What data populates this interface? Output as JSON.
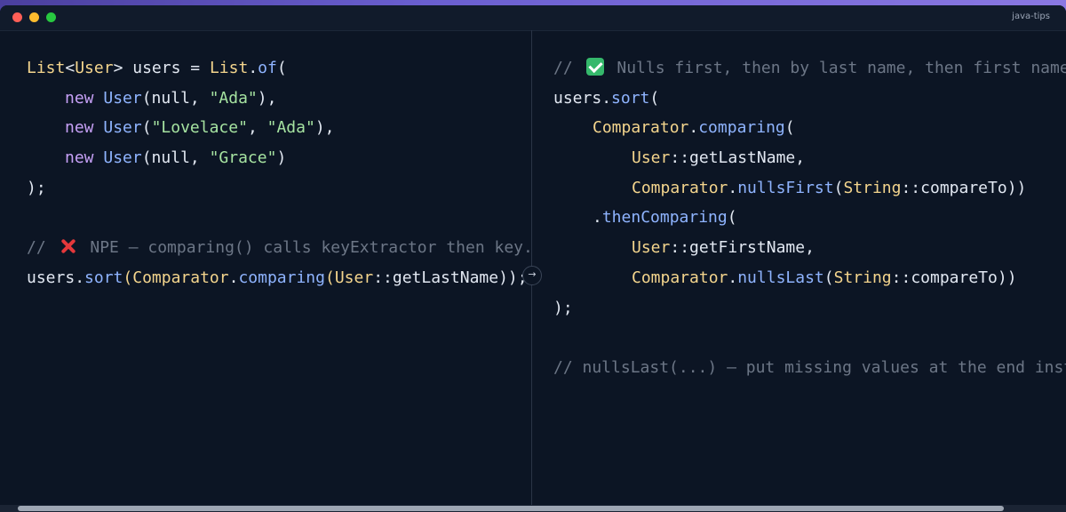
{
  "window": {
    "title": "java-tips",
    "colors": {
      "background": "#0c1524",
      "keyword": "#c6a0f6",
      "type": "#f4d58d",
      "function": "#8fb4ff",
      "string": "#a6e3a1",
      "comment": "#6c7686"
    }
  },
  "left": {
    "l1": {
      "list": "List",
      "lt": "<",
      "user": "User",
      "gt": ">",
      "users_eq": " users = ",
      "list2": "List",
      "dot": ".",
      "of": "of",
      "paren": "("
    },
    "l2": {
      "new": "new",
      "user": "User",
      "open": "(null, ",
      "str": "\"Ada\"",
      "close": "),"
    },
    "l3": {
      "new": "new",
      "user": "User",
      "open": "(",
      "str1": "\"Lovelace\"",
      "comma": ", ",
      "str2": "\"Ada\"",
      "close": "),"
    },
    "l4": {
      "new": "new",
      "user": "User",
      "open": "(null, ",
      "str": "\"Grace\"",
      "close": ")"
    },
    "l5": ");",
    "l6": {
      "pre": "// ",
      "emoji": "cross-mark-icon",
      "text": " NPE — comparing() calls keyExtractor then key.compareTo"
    },
    "l7": {
      "users": "users",
      "dot": ".",
      "sort": "sort",
      "open": "(",
      "comparator": "Comparator",
      "dot2": ".",
      "comparing": "comparing",
      "open2": "(",
      "user": "User",
      "ref": "::getLastName",
      "close": "));"
    }
  },
  "right": {
    "r1": {
      "pre": "// ",
      "emoji": "check-mark-icon",
      "text": " Nulls first, then by last name, then first name"
    },
    "r2": {
      "users": "users",
      "dot": ".",
      "sort": "sort",
      "open": "("
    },
    "r3": {
      "comparator": "Comparator",
      "dot": ".",
      "comparing": "comparing",
      "open": "("
    },
    "r4": {
      "user": "User",
      "ref": "::getLastName,"
    },
    "r5": {
      "comparator": "Comparator",
      "dot": ".",
      "nulls": "nullsFirst",
      "open": "(",
      "string": "String",
      "ref": "::compareTo",
      "close": "))"
    },
    "r6": {
      "dot": ".",
      "then": "thenComparing",
      "open": "("
    },
    "r7": {
      "user": "User",
      "ref": "::getFirstName,"
    },
    "r8": {
      "comparator": "Comparator",
      "dot": ".",
      "nulls": "nullsLast",
      "open": "(",
      "string": "String",
      "ref": "::compareTo",
      "close": "))"
    },
    "r9": ");",
    "r10": "// nullsLast(...) — put missing values at the end instead"
  },
  "divider": {
    "handle": "→"
  }
}
